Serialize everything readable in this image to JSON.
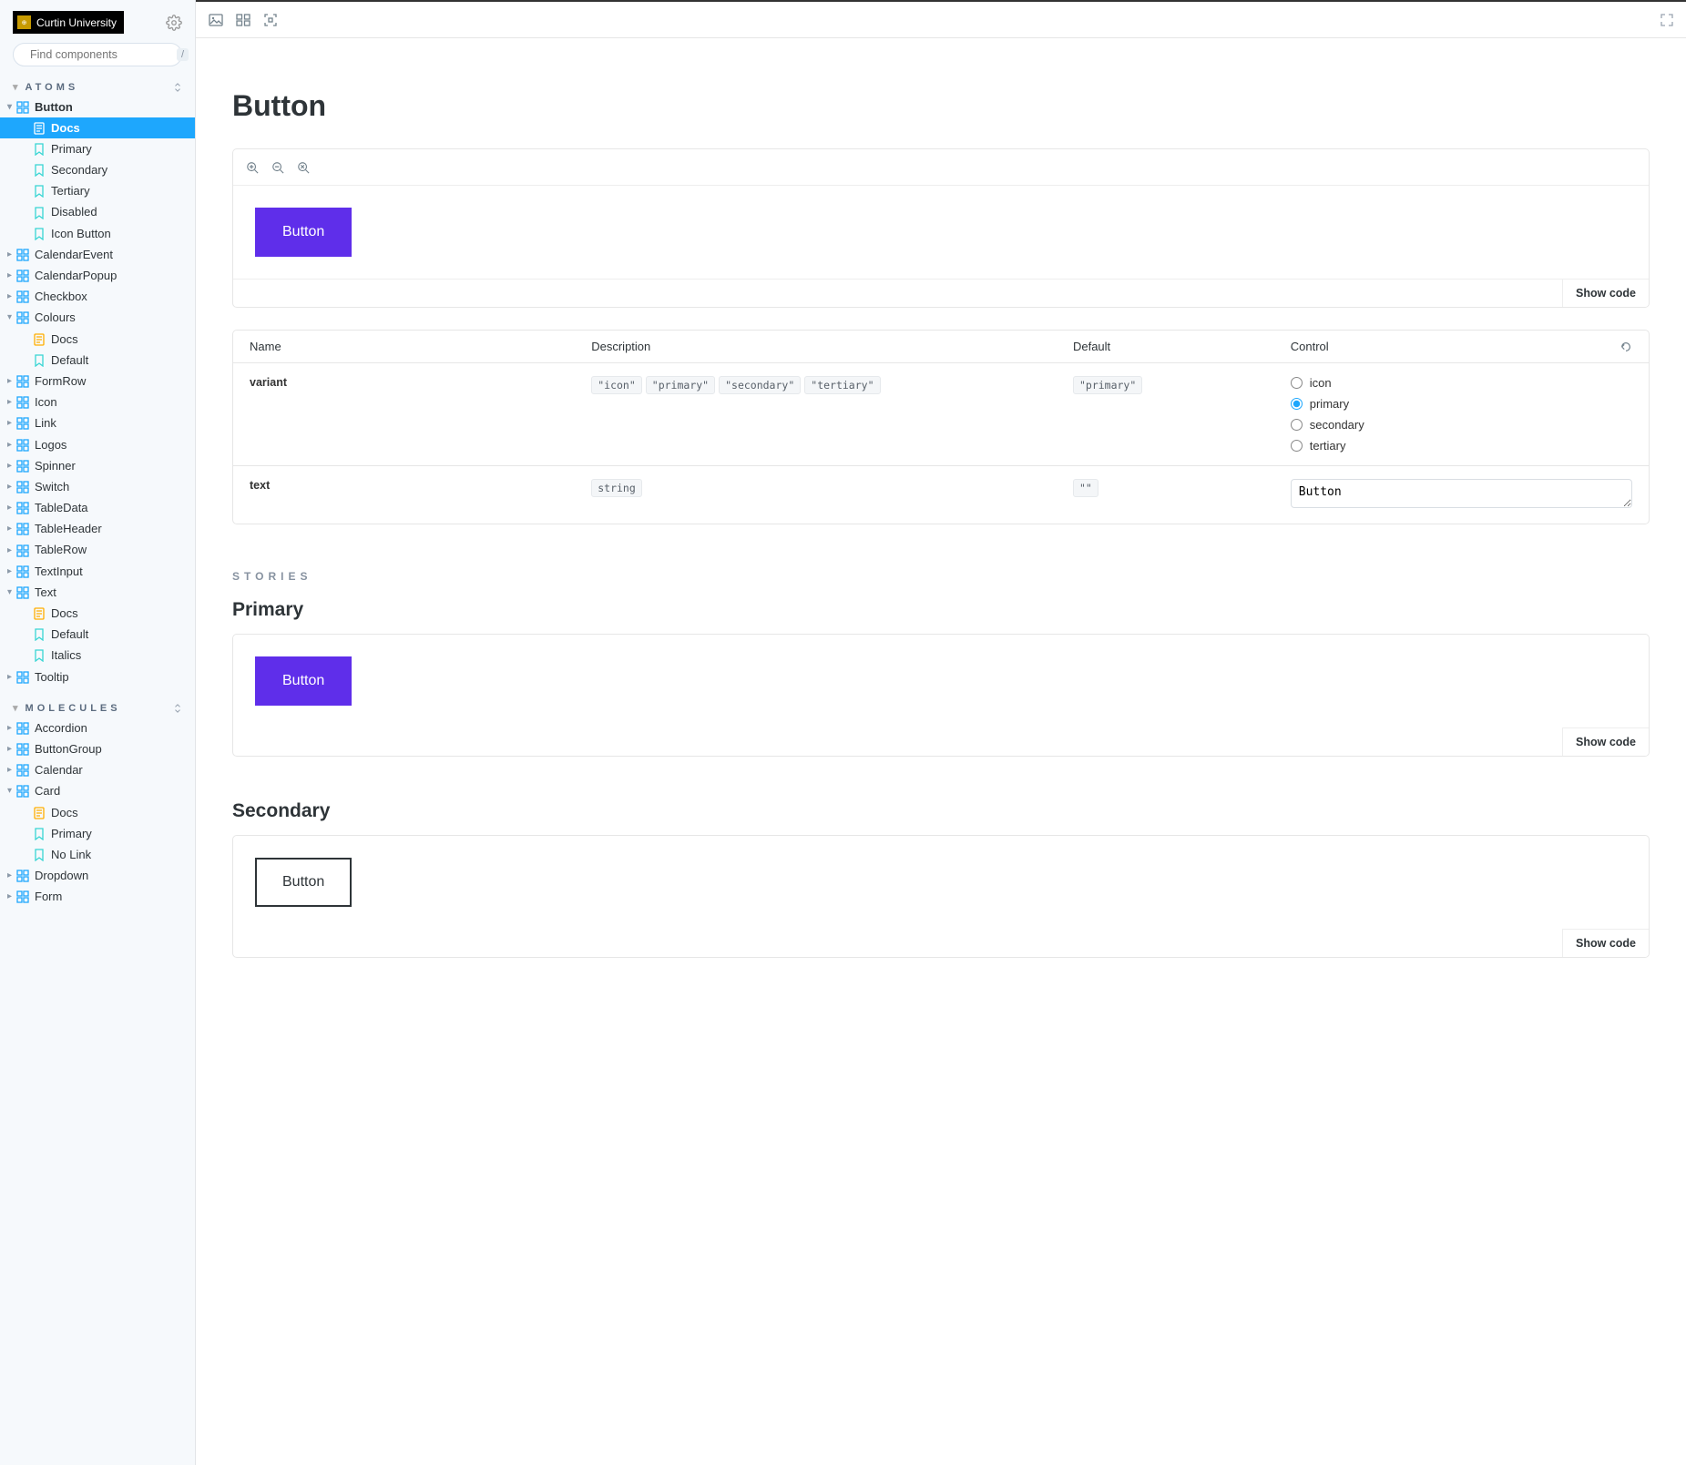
{
  "brand": {
    "text": "Curtin University"
  },
  "search": {
    "placeholder": "Find components",
    "hint": "/"
  },
  "sections": {
    "atoms": {
      "label": "ATOMS"
    },
    "molecules": {
      "label": "MOLECULES"
    }
  },
  "tree_atoms": [
    {
      "label": "Button",
      "depth": 1,
      "icon": "component",
      "expanded": true,
      "arrow": "down"
    },
    {
      "label": "Docs",
      "depth": 2,
      "icon": "doc",
      "selected": true
    },
    {
      "label": "Primary",
      "depth": 2,
      "icon": "story"
    },
    {
      "label": "Secondary",
      "depth": 2,
      "icon": "story"
    },
    {
      "label": "Tertiary",
      "depth": 2,
      "icon": "story"
    },
    {
      "label": "Disabled",
      "depth": 2,
      "icon": "story"
    },
    {
      "label": "Icon Button",
      "depth": 2,
      "icon": "story"
    },
    {
      "label": "CalendarEvent",
      "depth": 1,
      "icon": "component",
      "arrow": "right"
    },
    {
      "label": "CalendarPopup",
      "depth": 1,
      "icon": "component",
      "arrow": "right"
    },
    {
      "label": "Checkbox",
      "depth": 1,
      "icon": "component",
      "arrow": "right"
    },
    {
      "label": "Colours",
      "depth": 1,
      "icon": "component",
      "arrow": "down"
    },
    {
      "label": "Docs",
      "depth": 2,
      "icon": "doc"
    },
    {
      "label": "Default",
      "depth": 2,
      "icon": "story"
    },
    {
      "label": "FormRow",
      "depth": 1,
      "icon": "component",
      "arrow": "right"
    },
    {
      "label": "Icon",
      "depth": 1,
      "icon": "component",
      "arrow": "right"
    },
    {
      "label": "Link",
      "depth": 1,
      "icon": "component",
      "arrow": "right"
    },
    {
      "label": "Logos",
      "depth": 1,
      "icon": "component",
      "arrow": "right"
    },
    {
      "label": "Spinner",
      "depth": 1,
      "icon": "component",
      "arrow": "right"
    },
    {
      "label": "Switch",
      "depth": 1,
      "icon": "component",
      "arrow": "right"
    },
    {
      "label": "TableData",
      "depth": 1,
      "icon": "component",
      "arrow": "right"
    },
    {
      "label": "TableHeader",
      "depth": 1,
      "icon": "component",
      "arrow": "right"
    },
    {
      "label": "TableRow",
      "depth": 1,
      "icon": "component",
      "arrow": "right"
    },
    {
      "label": "TextInput",
      "depth": 1,
      "icon": "component",
      "arrow": "right"
    },
    {
      "label": "Text",
      "depth": 1,
      "icon": "component",
      "arrow": "down"
    },
    {
      "label": "Docs",
      "depth": 2,
      "icon": "doc"
    },
    {
      "label": "Default",
      "depth": 2,
      "icon": "story"
    },
    {
      "label": "Italics",
      "depth": 2,
      "icon": "story"
    },
    {
      "label": "Tooltip",
      "depth": 1,
      "icon": "component",
      "arrow": "right"
    }
  ],
  "tree_molecules": [
    {
      "label": "Accordion",
      "depth": 1,
      "icon": "component",
      "arrow": "right"
    },
    {
      "label": "ButtonGroup",
      "depth": 1,
      "icon": "component",
      "arrow": "right"
    },
    {
      "label": "Calendar",
      "depth": 1,
      "icon": "component",
      "arrow": "right"
    },
    {
      "label": "Card",
      "depth": 1,
      "icon": "component",
      "arrow": "down"
    },
    {
      "label": "Docs",
      "depth": 2,
      "icon": "doc"
    },
    {
      "label": "Primary",
      "depth": 2,
      "icon": "story"
    },
    {
      "label": "No Link",
      "depth": 2,
      "icon": "story"
    },
    {
      "label": "Dropdown",
      "depth": 1,
      "icon": "component",
      "arrow": "right"
    },
    {
      "label": "Form",
      "depth": 1,
      "icon": "component",
      "arrow": "right"
    }
  ],
  "page": {
    "title": "Button",
    "show_code": "Show code",
    "stories_label": "STORIES"
  },
  "preview": {
    "button_text": "Button"
  },
  "args": {
    "headers": {
      "name": "Name",
      "description": "Description",
      "default": "Default",
      "control": "Control"
    },
    "rows": [
      {
        "name": "variant",
        "options": [
          "\"icon\"",
          "\"primary\"",
          "\"secondary\"",
          "\"tertiary\""
        ],
        "default_pill": "\"primary\"",
        "control": {
          "type": "radio",
          "options": [
            "icon",
            "primary",
            "secondary",
            "tertiary"
          ],
          "selected": "primary"
        }
      },
      {
        "name": "text",
        "type_pill": "string",
        "default_pill": "\"\"",
        "control": {
          "type": "text",
          "value": "Button"
        }
      }
    ]
  },
  "stories": [
    {
      "title": "Primary",
      "variant": "primary",
      "text": "Button"
    },
    {
      "title": "Secondary",
      "variant": "secondary",
      "text": "Button"
    }
  ]
}
